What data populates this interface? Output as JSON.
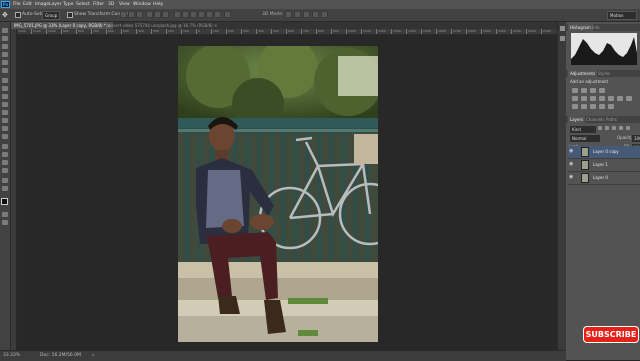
{
  "app": {
    "logo_text": "Ps"
  },
  "menu": [
    "File",
    "Edit",
    "Image",
    "Layer",
    "Type",
    "Select",
    "Filter",
    "3D",
    "View",
    "Window",
    "Help"
  ],
  "window_controls": {
    "minimize": "–",
    "maximize": "□",
    "close": "✕"
  },
  "options": {
    "auto_select_label": "Auto-Select:",
    "auto_select_value": "Group",
    "transform_label": "Show Transform Controls",
    "mode_label": "3D Mode:",
    "workspace": "Motion"
  },
  "tabs": [
    {
      "label": "IMG_5701.JPG @ 33% (Layer 0 copy, RGB/8) *",
      "close": "×"
    },
    {
      "label": "convert video 575744 unsplash.jpg @ 16.7% (RGB/8)",
      "close": "×"
    }
  ],
  "ruler_top_labels": [
    "1200",
    "1100",
    "1000",
    "900",
    "800",
    "700",
    "600",
    "500",
    "400",
    "300",
    "200",
    "100",
    "0",
    "100",
    "200",
    "300",
    "400",
    "500",
    "600",
    "700",
    "800",
    "900",
    "1000",
    "1100",
    "1200",
    "1300",
    "1400",
    "1500",
    "1600",
    "1700",
    "1800",
    "1900",
    "2000",
    "2100",
    "2200",
    "2300"
  ],
  "statusbar": {
    "zoom": "33.33%",
    "doc": "Doc: 16.2M/56.0M",
    "arrow": "›"
  },
  "panels": {
    "histogram_tabs": [
      "Histogram",
      "Info"
    ],
    "adjustments_tabs": [
      "Adjustments",
      "Styles"
    ],
    "add_adjustment": "Add an adjustment",
    "layers_tabs": [
      "Layers",
      "Channels",
      "Paths"
    ],
    "filter_kind": "Kind",
    "blend_mode": "Normal",
    "opacity_label": "Opacity:",
    "opacity_value": "100%",
    "lock_label": "Lock:",
    "fill_label": "Fill:",
    "fill_value": "100%",
    "layers": [
      {
        "name": "Layer 0 copy",
        "selected": true
      },
      {
        "name": "Layer 1",
        "selected": false
      },
      {
        "name": "Layer 0",
        "selected": false
      }
    ]
  },
  "overlay": {
    "subscribe": "SUBSCRIBE"
  },
  "colors": {
    "accent": "#31a8ff",
    "selection": "#465a78",
    "subscribe": "#e62117"
  }
}
